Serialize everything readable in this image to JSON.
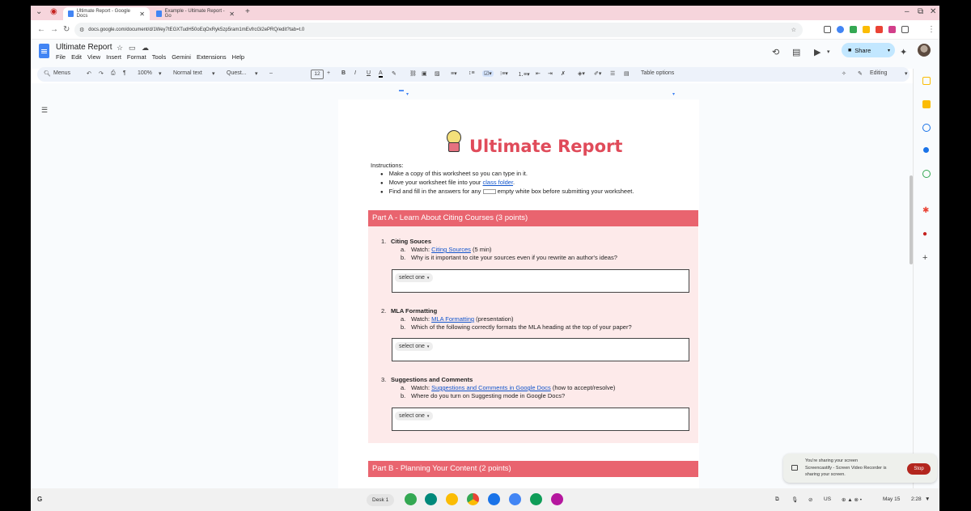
{
  "browser": {
    "tabs": [
      {
        "label": "Ultimate Report - Google Docs",
        "active": true
      },
      {
        "label": "Example - Ultimate Report - Go",
        "active": false
      }
    ],
    "new_tab": "+",
    "url": "docs.google.com/document/d/1Wey7tEGXTudH50oEqOxRyk5zp5ram1mEvfrcGl2ePRQ/edit?tab=t.0"
  },
  "docs": {
    "title": "Ultimate Report",
    "menu": [
      "File",
      "Edit",
      "View",
      "Insert",
      "Format",
      "Tools",
      "Gemini",
      "Extensions",
      "Help"
    ],
    "share_label": "Share"
  },
  "toolbar": {
    "menus_label": "Menus",
    "zoom": "100%",
    "style": "Normal text",
    "font": "Quest...",
    "font_size": "12",
    "table_options": "Table options",
    "mode": "Editing"
  },
  "document": {
    "heading": "Ultimate Report",
    "instructions_label": "Instructions:",
    "instructions": {
      "item1": "Make a copy of this worksheet so you can type in it.",
      "item2_pre": "Move your worksheet file into your ",
      "item2_link": "class folder",
      "item2_post": ".",
      "item3_pre": "Find and fill in the answers for any ",
      "item3_post": " empty white box before submitting your worksheet."
    },
    "partA": {
      "title": "Part A - Learn About Citing Courses (3 points)",
      "questions": [
        {
          "num": "1.",
          "title": "Citing Souces",
          "a_label": "a.",
          "a_pre": "Watch: ",
          "a_link": "Citing Sources",
          "a_post": " (5 min)",
          "b_label": "b.",
          "b_text": "Why is it important to cite your sources even if you rewrite an author's ideas?",
          "answer": "select one"
        },
        {
          "num": "2.",
          "title": "MLA Formatting",
          "a_label": "a.",
          "a_pre": "Watch: ",
          "a_link": "MLA Formatting",
          "a_post": " (presentation)",
          "b_label": "b.",
          "b_text": "Which of the following correctly formats the MLA heading at the top of your paper?",
          "answer": "select one"
        },
        {
          "num": "3.",
          "title": "Suggestions and Comments",
          "a_label": "a.",
          "a_pre": "Watch: ",
          "a_link": "Suggestions and Comments in Google Docs",
          "a_post": " (how to accept/resolve)",
          "b_label": "b.",
          "b_text": "Where do you turn on Suggesting mode in Google Docs?",
          "answer": "select one"
        }
      ]
    },
    "partB": {
      "title": "Part B - Planning Your Content (2 points)"
    }
  },
  "notification": {
    "line1": "You're sharing your screen",
    "line2": "Screencastify - Screen Video Recorder is sharing your screen.",
    "stop": "Stop"
  },
  "shelf": {
    "desk": "Desk 1",
    "locale": "US",
    "date": "May 15",
    "time": "2:28"
  },
  "colors": {
    "section_header": "#e9646f",
    "section_body": "#fdeaea",
    "title_red": "#e04b5a",
    "share_bg": "#c2e7ff",
    "stop_red": "#b3261e"
  }
}
